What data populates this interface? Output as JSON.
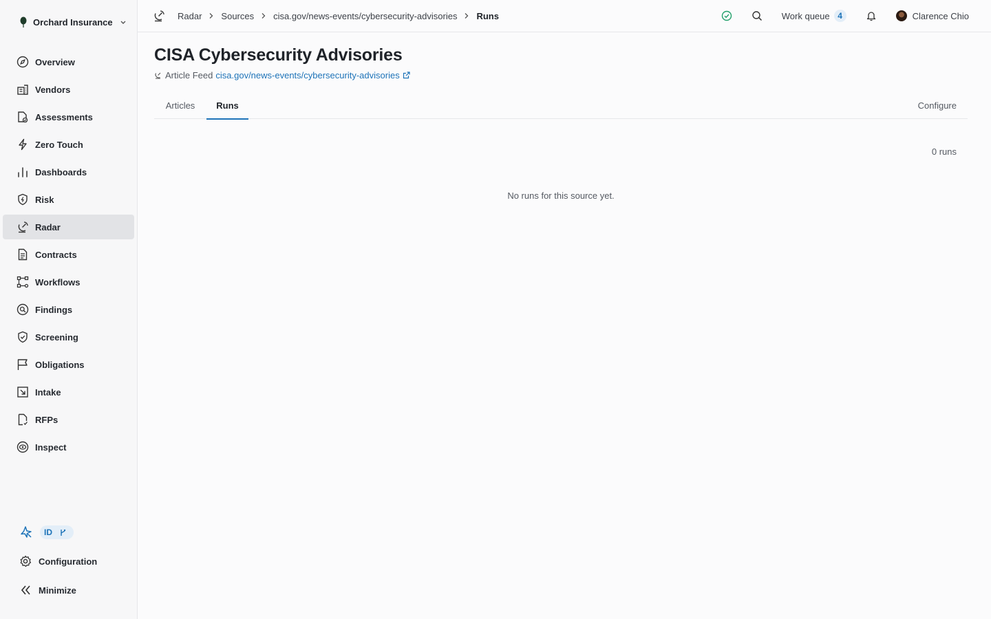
{
  "org": {
    "name": "Orchard Insurance"
  },
  "nav": [
    {
      "label": "Overview",
      "icon": "compass-icon"
    },
    {
      "label": "Vendors",
      "icon": "building-icon"
    },
    {
      "label": "Assessments",
      "icon": "file-check-icon"
    },
    {
      "label": "Zero Touch",
      "icon": "lightning-icon"
    },
    {
      "label": "Dashboards",
      "icon": "bar-chart-icon"
    },
    {
      "label": "Risk",
      "icon": "shield-icon"
    },
    {
      "label": "Radar",
      "icon": "radar-icon",
      "active": true
    },
    {
      "label": "Contracts",
      "icon": "document-icon"
    },
    {
      "label": "Workflows",
      "icon": "workflow-icon"
    },
    {
      "label": "Findings",
      "icon": "magnifier-icon"
    },
    {
      "label": "Screening",
      "icon": "shield-check-icon"
    },
    {
      "label": "Obligations",
      "icon": "flag-icon"
    },
    {
      "label": "Intake",
      "icon": "inbox-arrow-icon"
    },
    {
      "label": "RFPs",
      "icon": "file-check-icon"
    },
    {
      "label": "Inspect",
      "icon": "eye-icon"
    }
  ],
  "sidebar_bottom": {
    "id_chip": "ID",
    "configuration": "Configuration",
    "minimize": "Minimize"
  },
  "breadcrumb": {
    "items": [
      "Radar",
      "Sources",
      "cisa.gov/news-events/cybersecurity-advisories"
    ],
    "current": "Runs"
  },
  "topbar": {
    "work_queue_label": "Work queue",
    "work_queue_count": "4",
    "user_name": "Clarence Chio"
  },
  "page": {
    "title": "CISA Cybersecurity Advisories",
    "feed_type": "Article Feed",
    "feed_url": "cisa.gov/news-events/cybersecurity-advisories"
  },
  "tabs": {
    "articles": "Articles",
    "runs": "Runs",
    "configure": "Configure"
  },
  "runs": {
    "count_label": "0 runs",
    "empty_message": "No runs for this source yet."
  },
  "colors": {
    "accent": "#1d73b8",
    "active_nav_bg": "#e2e3e6",
    "status_ok": "#22a06b"
  }
}
